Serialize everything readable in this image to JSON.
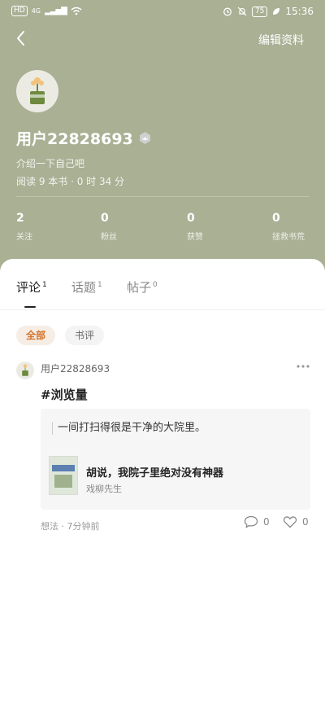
{
  "status_bar": {
    "hd": "HD",
    "net": "4G",
    "battery": "75",
    "time": "15:36"
  },
  "header": {
    "edit_profile": "编辑资料",
    "username": "用户22828693",
    "bio": "介绍一下自己吧",
    "reading_stats": "阅读 9 本书 · 0 时 34 分",
    "stats": [
      {
        "value": "2",
        "label": "关注"
      },
      {
        "value": "0",
        "label": "粉丝"
      },
      {
        "value": "0",
        "label": "获赞"
      },
      {
        "value": "0",
        "label": "拯救书荒"
      }
    ]
  },
  "tabs": [
    {
      "label": "评论",
      "count": "1"
    },
    {
      "label": "话题",
      "count": "1"
    },
    {
      "label": "帖子",
      "count": "0"
    }
  ],
  "filters": [
    "全部",
    "书评"
  ],
  "post": {
    "user": "用户22828693",
    "title": "#浏览量",
    "quote": "一间打扫得很是干净的大院里。",
    "book_title": "胡说，我院子里绝对没有神器",
    "book_author": "戏柳先生",
    "category": "想法",
    "time": "7分钟前",
    "comments": "0",
    "likes": "0"
  }
}
